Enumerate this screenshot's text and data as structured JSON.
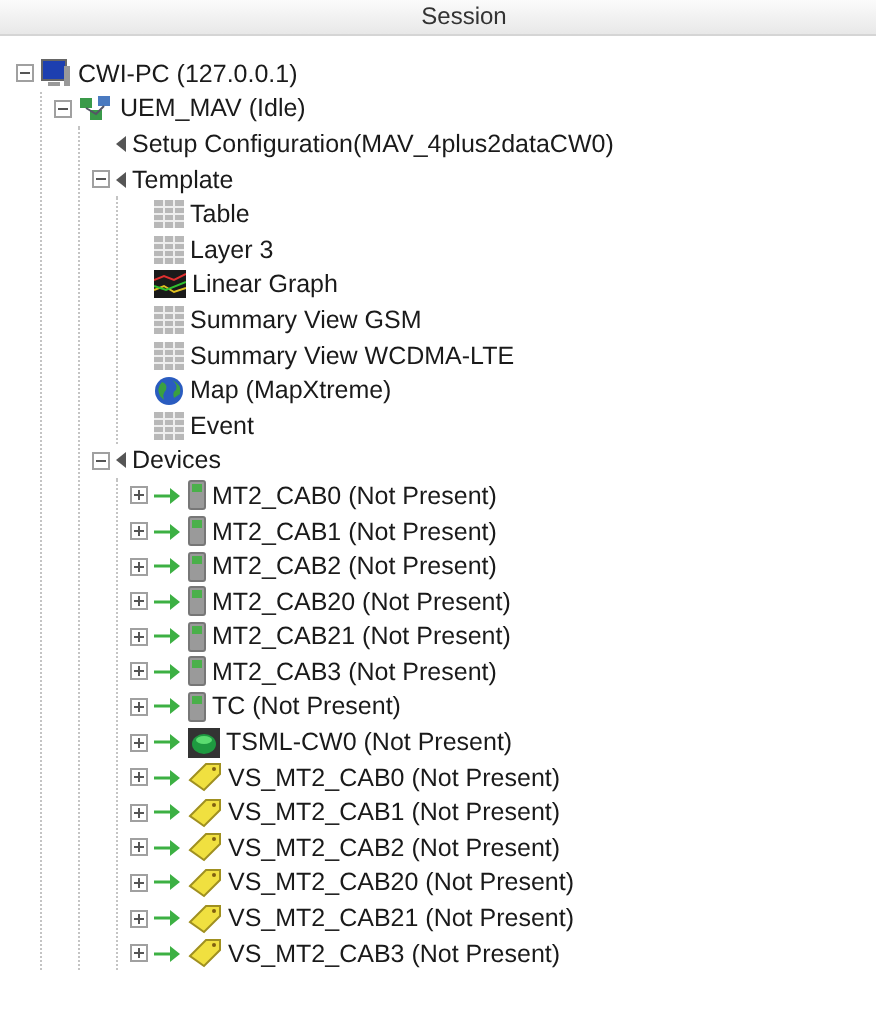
{
  "header": {
    "title": "Session"
  },
  "tree": [
    {
      "label": "CWI-PC (127.0.0.1)",
      "kind": "computer",
      "expanded": true,
      "children": [
        {
          "label": "UEM_MAV (Idle)",
          "kind": "network",
          "expanded": true,
          "children": [
            {
              "label": "Setup Configuration(MAV_4plus2dataCW0)",
              "kind": "section"
            },
            {
              "label": "Template",
              "kind": "section",
              "expanded": true,
              "children": [
                {
                  "label": "Table",
                  "kind": "grid"
                },
                {
                  "label": "Layer 3",
                  "kind": "grid"
                },
                {
                  "label": "Linear Graph",
                  "kind": "graph"
                },
                {
                  "label": "Summary View GSM",
                  "kind": "grid"
                },
                {
                  "label": "Summary View WCDMA-LTE",
                  "kind": "grid"
                },
                {
                  "label": "Map (MapXtreme)",
                  "kind": "globe"
                },
                {
                  "label": "Event",
                  "kind": "grid"
                }
              ]
            },
            {
              "label": "Devices",
              "kind": "section",
              "expanded": true,
              "children": [
                {
                  "label": "MT2_CAB0 (Not Present)",
                  "kind": "phone",
                  "expanded": false
                },
                {
                  "label": "MT2_CAB1 (Not Present)",
                  "kind": "phone",
                  "expanded": false
                },
                {
                  "label": "MT2_CAB2 (Not Present)",
                  "kind": "phone",
                  "expanded": false
                },
                {
                  "label": "MT2_CAB20 (Not Present)",
                  "kind": "phone",
                  "expanded": false
                },
                {
                  "label": "MT2_CAB21 (Not Present)",
                  "kind": "phone",
                  "expanded": false
                },
                {
                  "label": "MT2_CAB3 (Not Present)",
                  "kind": "phone",
                  "expanded": false
                },
                {
                  "label": "TC (Not Present)",
                  "kind": "phone",
                  "expanded": false
                },
                {
                  "label": "TSML-CW0 (Not Present)",
                  "kind": "scanner",
                  "expanded": false
                },
                {
                  "label": "VS_MT2_CAB0 (Not Present)",
                  "kind": "tag",
                  "expanded": false
                },
                {
                  "label": "VS_MT2_CAB1 (Not Present)",
                  "kind": "tag",
                  "expanded": false
                },
                {
                  "label": "VS_MT2_CAB2 (Not Present)",
                  "kind": "tag",
                  "expanded": false
                },
                {
                  "label": "VS_MT2_CAB20 (Not Present)",
                  "kind": "tag",
                  "expanded": false
                },
                {
                  "label": "VS_MT2_CAB21 (Not Present)",
                  "kind": "tag",
                  "expanded": false
                },
                {
                  "label": "VS_MT2_CAB3 (Not Present)",
                  "kind": "tag",
                  "expanded": false
                }
              ]
            }
          ]
        }
      ]
    }
  ]
}
